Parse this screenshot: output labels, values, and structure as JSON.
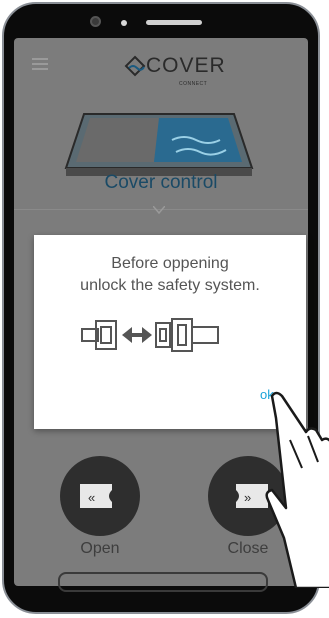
{
  "app": {
    "logo_text": "COVER",
    "logo_sub": "CONNECT",
    "section_title": "Cover control"
  },
  "dialog": {
    "line1": "Before oppening",
    "line2": "unlock the safety system.",
    "ok_label": "ok"
  },
  "actions": {
    "open_label": "Open",
    "close_label": "Close"
  },
  "colors": {
    "accent": "#1aa3d9",
    "title": "#1a4a66"
  }
}
